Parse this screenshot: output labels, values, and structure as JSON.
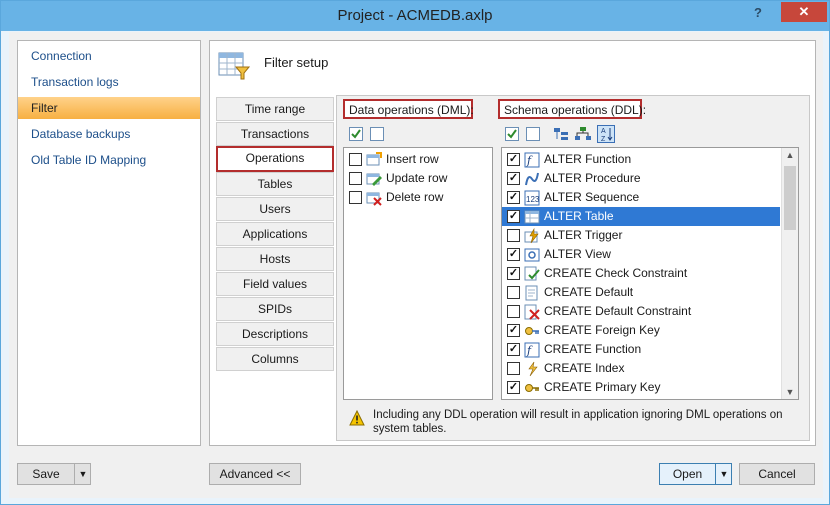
{
  "window": {
    "title": "Project - ACMEDB.axlp",
    "help_glyph": "?",
    "close_glyph": "✕"
  },
  "nav": {
    "items": [
      {
        "label": "Connection"
      },
      {
        "label": "Transaction logs"
      },
      {
        "label": "Filter",
        "active": true
      },
      {
        "label": "Database backups"
      },
      {
        "label": "Old Table ID Mapping"
      }
    ]
  },
  "main": {
    "title": "Filter setup",
    "tabs": [
      {
        "label": "Time range"
      },
      {
        "label": "Transactions"
      },
      {
        "label": "Operations",
        "selected": true
      },
      {
        "label": "Tables"
      },
      {
        "label": "Users"
      },
      {
        "label": "Applications"
      },
      {
        "label": "Hosts"
      },
      {
        "label": "Field values"
      },
      {
        "label": "SPIDs"
      },
      {
        "label": "Descriptions"
      },
      {
        "label": "Columns"
      }
    ],
    "dml": {
      "label": "Data operations (DML):",
      "items": [
        {
          "label": "Insert row",
          "checked": false,
          "icon": "insert-row-icon"
        },
        {
          "label": "Update row",
          "checked": false,
          "icon": "update-row-icon"
        },
        {
          "label": "Delete row",
          "checked": false,
          "icon": "delete-row-icon"
        }
      ]
    },
    "ddl": {
      "label": "Schema operations (DDL):",
      "items": [
        {
          "label": "ALTER Function",
          "checked": true,
          "icon": "function-icon"
        },
        {
          "label": "ALTER Procedure",
          "checked": true,
          "icon": "procedure-icon"
        },
        {
          "label": "ALTER Sequence",
          "checked": true,
          "icon": "sequence-icon"
        },
        {
          "label": "ALTER Table",
          "checked": true,
          "icon": "table-icon",
          "highlighted": true
        },
        {
          "label": "ALTER Trigger",
          "checked": false,
          "icon": "trigger-icon"
        },
        {
          "label": "ALTER View",
          "checked": true,
          "icon": "view-icon"
        },
        {
          "label": "CREATE Check Constraint",
          "checked": true,
          "icon": "check-constraint-icon"
        },
        {
          "label": "CREATE Default",
          "checked": false,
          "icon": "default-icon"
        },
        {
          "label": "CREATE Default Constraint",
          "checked": false,
          "icon": "default-constraint-icon"
        },
        {
          "label": "CREATE Foreign Key",
          "checked": true,
          "icon": "foreign-key-icon"
        },
        {
          "label": "CREATE Function",
          "checked": true,
          "icon": "function-icon"
        },
        {
          "label": "CREATE Index",
          "checked": false,
          "icon": "index-icon"
        },
        {
          "label": "CREATE Primary Key",
          "checked": true,
          "icon": "primary-key-icon"
        }
      ]
    },
    "note": "Including any DDL operation will result in application ignoring DML operations on system tables."
  },
  "buttons": {
    "save": "Save",
    "advanced": "Advanced <<",
    "open": "Open",
    "cancel": "Cancel"
  },
  "colors": {
    "highlight": "#2f79d4",
    "nav_active": "#f7b042",
    "callout_border": "#b32d2d",
    "titlebar": "#68b3e6",
    "close": "#c7473b"
  }
}
